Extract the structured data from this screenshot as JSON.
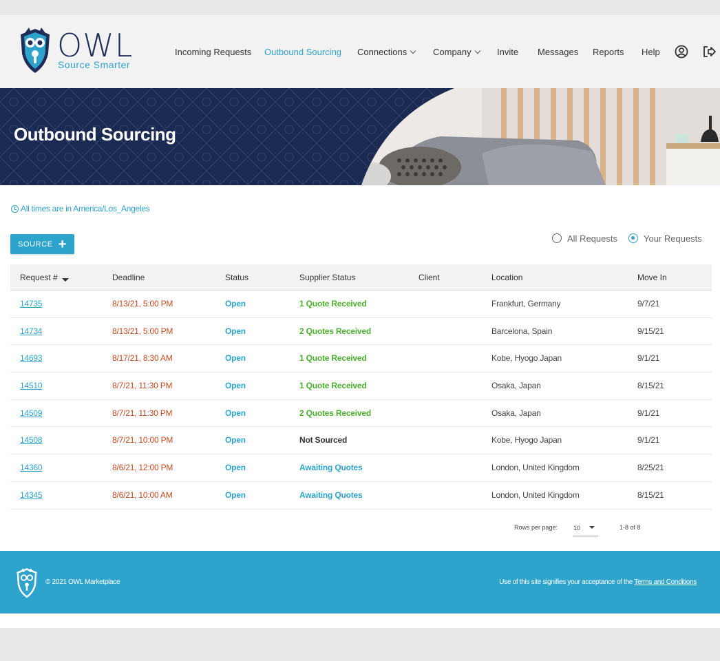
{
  "brand": {
    "name": "OWL",
    "tagline": "Source Smarter",
    "navy": "#1f2d58",
    "accent": "#2ea3cc"
  },
  "nav": {
    "items": [
      {
        "label": "Incoming Requests",
        "dropdown": false,
        "active": false
      },
      {
        "label": "Outbound Sourcing",
        "dropdown": false,
        "active": true
      },
      {
        "label": "Connections",
        "dropdown": true,
        "active": false
      },
      {
        "label": "Company",
        "dropdown": true,
        "active": false
      },
      {
        "label": "Invite",
        "dropdown": false,
        "active": false
      },
      {
        "label": "Messages",
        "dropdown": false,
        "active": false
      },
      {
        "label": "Reports",
        "dropdown": false,
        "active": false
      },
      {
        "label": "Help",
        "dropdown": false,
        "active": false
      }
    ],
    "icons": [
      "account-icon",
      "logout-icon"
    ]
  },
  "banner": {
    "title": "Outbound Sourcing"
  },
  "main": {
    "timezone_note": "All times are in America/Los_Angeles",
    "source_button": "SOURCE",
    "filter": {
      "options": [
        "All Requests",
        "Your Requests"
      ],
      "selected": "Your Requests"
    },
    "table": {
      "columns": [
        "Request #",
        "Deadline",
        "Status",
        "Supplier Status",
        "Client",
        "Location",
        "Move In"
      ],
      "rows": [
        {
          "request": "14735",
          "deadline": "8/13/21, 5:00 PM",
          "status": "Open",
          "supplier_status": "1 Quote Received",
          "supplier_kind": "green",
          "client": "",
          "location": "Frankfurt, Germany",
          "move_in": "9/7/21"
        },
        {
          "request": "14734",
          "deadline": "8/13/21, 5:00 PM",
          "status": "Open",
          "supplier_status": "2 Quotes Received",
          "supplier_kind": "green",
          "client": "",
          "location": "Barcelona, Spain",
          "move_in": "9/15/21"
        },
        {
          "request": "14693",
          "deadline": "8/17/21, 8:30 AM",
          "status": "Open",
          "supplier_status": "1 Quote Received",
          "supplier_kind": "green",
          "client": "",
          "location": "Kobe, Hyogo Japan",
          "move_in": "9/1/21"
        },
        {
          "request": "14510",
          "deadline": "8/7/21, 11:30 PM",
          "status": "Open",
          "supplier_status": "1 Quote Received",
          "supplier_kind": "green",
          "client": "",
          "location": "Osaka, Japan",
          "move_in": "8/15/21"
        },
        {
          "request": "14509",
          "deadline": "8/7/21, 11:30 PM",
          "status": "Open",
          "supplier_status": "2 Quotes Received",
          "supplier_kind": "green",
          "client": "",
          "location": "Osaka, Japan",
          "move_in": "9/1/21"
        },
        {
          "request": "14508",
          "deadline": "8/7/21, 10:00 PM",
          "status": "Open",
          "supplier_status": "Not Sourced",
          "supplier_kind": "dark",
          "client": "",
          "location": "Kobe, Hyogo Japan",
          "move_in": "9/1/21"
        },
        {
          "request": "14360",
          "deadline": "8/6/21, 12:00 PM",
          "status": "Open",
          "supplier_status": "Awaiting Quotes",
          "supplier_kind": "blue",
          "client": "",
          "location": "London, United Kingdom",
          "move_in": "8/25/21"
        },
        {
          "request": "14345",
          "deadline": "8/6/21, 10:00 AM",
          "status": "Open",
          "supplier_status": "Awaiting Quotes",
          "supplier_kind": "blue",
          "client": "",
          "location": "London, United Kingdom",
          "move_in": "8/15/21"
        }
      ]
    },
    "pagination": {
      "rows_per_page_label": "Rows per page:",
      "rows_per_page": "10",
      "range": "1-8 of 8"
    }
  },
  "footer": {
    "copyright": "© 2021 OWL Marketplace",
    "terms_prefix": "Use of this site signifies your acceptance of the",
    "terms_link": "Terms and Conditions"
  }
}
